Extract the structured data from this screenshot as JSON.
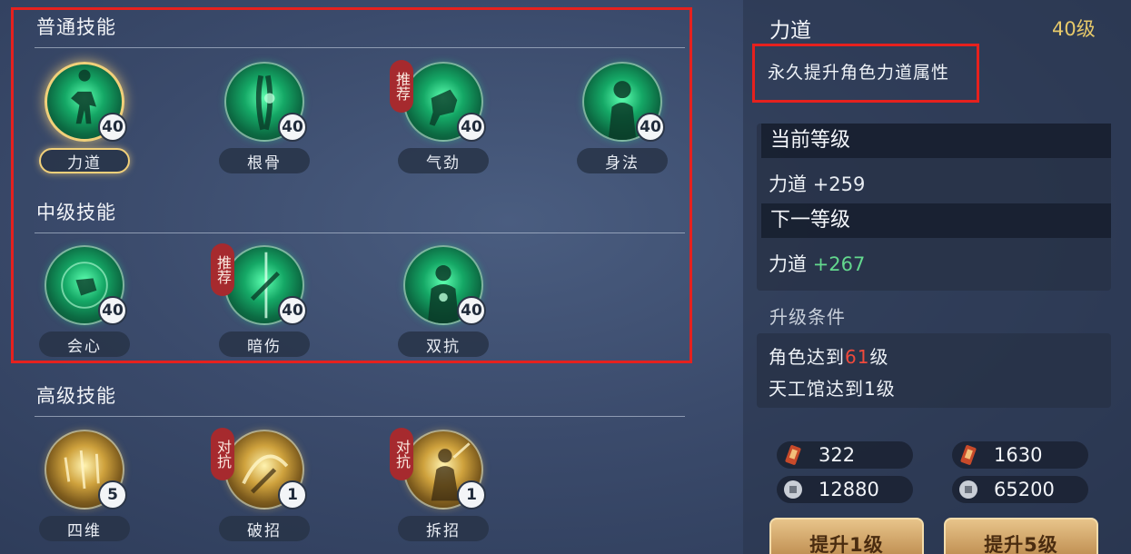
{
  "sections": {
    "normal": {
      "title": "普通技能"
    },
    "intermediate": {
      "title": "中级技能"
    },
    "advanced": {
      "title": "高级技能"
    }
  },
  "skills": {
    "normal": [
      {
        "name": "力道",
        "level": "40",
        "tag": "",
        "selected": true
      },
      {
        "name": "根骨",
        "level": "40",
        "tag": ""
      },
      {
        "name": "气劲",
        "level": "40",
        "tag": "推荐"
      },
      {
        "name": "身法",
        "level": "40",
        "tag": ""
      }
    ],
    "intermediate": [
      {
        "name": "会心",
        "level": "40",
        "tag": ""
      },
      {
        "name": "暗伤",
        "level": "40",
        "tag": "推荐"
      },
      {
        "name": "双抗",
        "level": "40",
        "tag": ""
      }
    ],
    "advanced": [
      {
        "name": "四维",
        "level": "5",
        "tag": ""
      },
      {
        "name": "破招",
        "level": "1",
        "tag": "对抗"
      },
      {
        "name": "拆招",
        "level": "1",
        "tag": "对抗"
      }
    ]
  },
  "detail": {
    "title": "力道",
    "level": "40级",
    "description": "永久提升角色力道属性",
    "current_header": "当前等级",
    "current_stat": "力道",
    "current_value": "+259",
    "next_header": "下一等级",
    "next_stat": "力道",
    "next_value": "+267",
    "cond_title": "升级条件",
    "cond1_pre": "角色达到",
    "cond1_num": "61",
    "cond1_post": "级",
    "cond2": "天工馆达到1级",
    "cost1_token": "322",
    "cost1_coin": "12880",
    "cost5_token": "1630",
    "cost5_coin": "65200",
    "btn1": "提升1级",
    "btn5": "提升5级"
  },
  "colors": {
    "highlight_box": "#e6211e",
    "level_gold": "#e7c96a",
    "next_value_green": "#63d88e",
    "condition_red": "#f04a3c",
    "tag_red": "#a62a2e"
  }
}
